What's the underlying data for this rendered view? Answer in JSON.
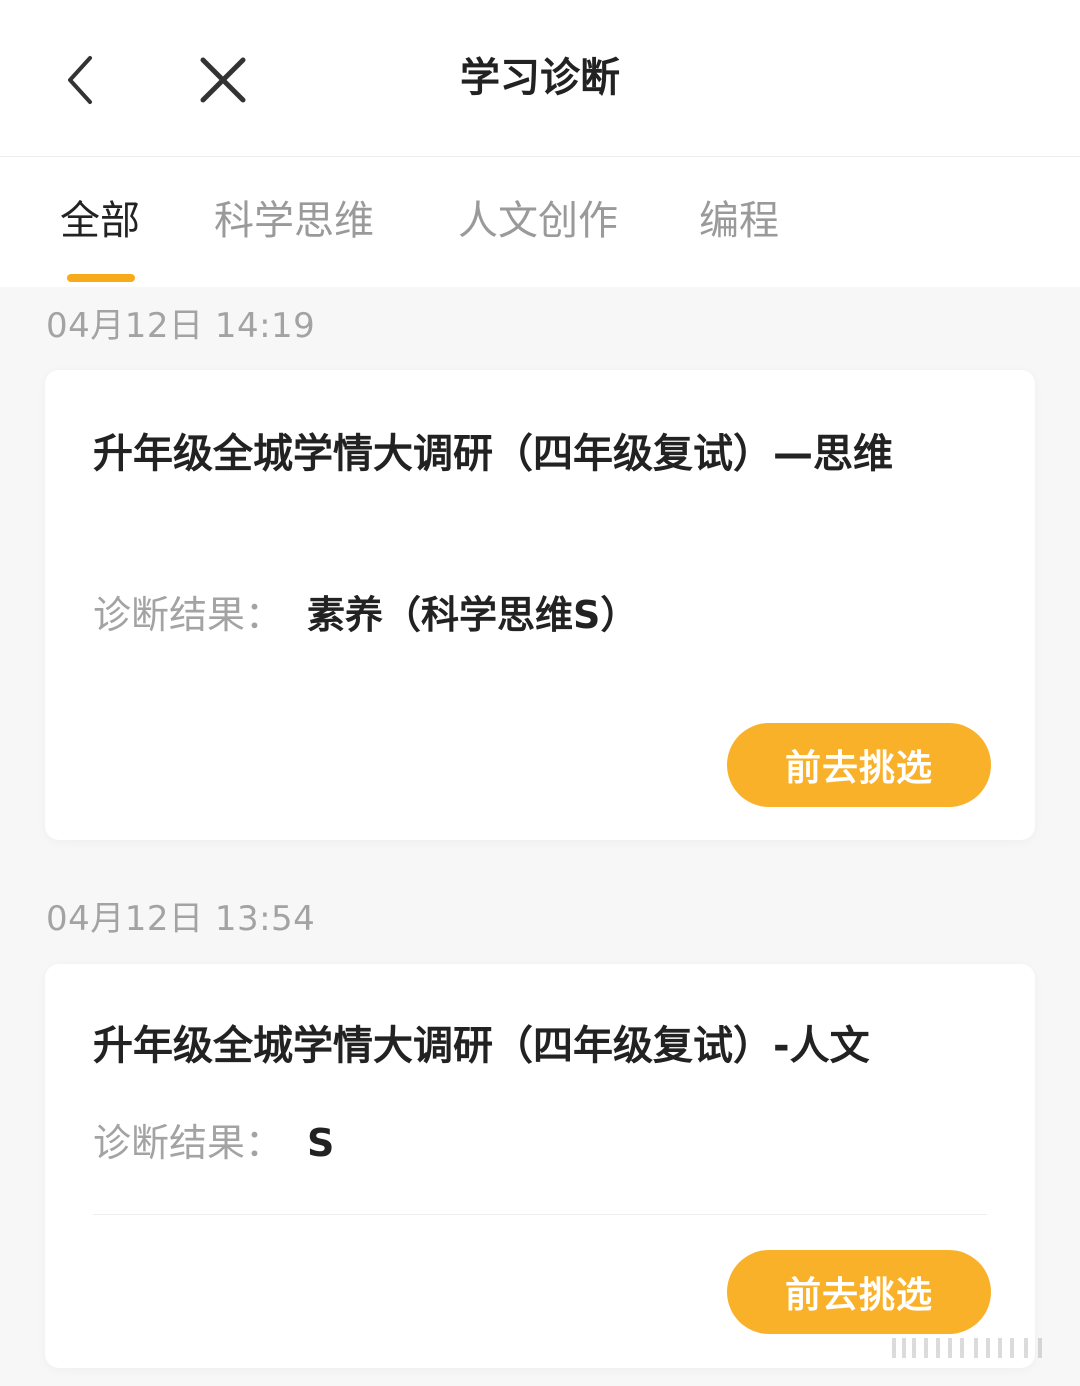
{
  "header": {
    "title": "学习诊断",
    "back_icon": "chevron-left-icon",
    "close_icon": "close-icon"
  },
  "tabs": [
    {
      "label": "全部",
      "active": true
    },
    {
      "label": "科学思维",
      "active": false
    },
    {
      "label": "人文创作",
      "active": false
    },
    {
      "label": "编程",
      "active": false
    }
  ],
  "records": [
    {
      "date": "04月12日 14:19",
      "title": "升年级全城学情大调研（四年级复试）—思维",
      "result_label": "诊断结果：",
      "result_value": "素养（科学思维S）",
      "button_label": "前去挑选"
    },
    {
      "date": "04月12日 13:54",
      "title": "升年级全城学情大调研（四年级复试）-人文",
      "result_label": "诊断结果：",
      "result_value": "S",
      "button_label": "前去挑选"
    }
  ],
  "colors": {
    "accent": "#f9b12a",
    "tab_indicator": "#f7ab1a",
    "muted_text": "#a3a3a3",
    "primary_text": "#222222"
  }
}
